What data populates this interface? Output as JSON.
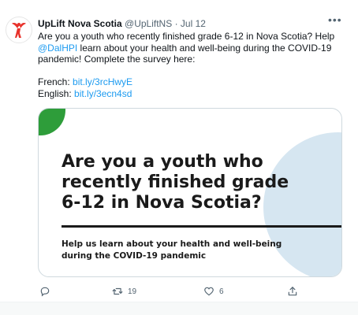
{
  "tweet": {
    "display_name": "UpLift Nova Scotia",
    "handle": "@UpLiftNS",
    "separator": "·",
    "date": "Jul 12",
    "more_icon": "more-horizontal-icon",
    "text_line1": "Are you a youth who recently finished grade 6-12 in Nova Scotia? Help",
    "mention": "@DalHPI",
    "text_line2_rest": " learn about your health and well-being during the COVID-19",
    "text_line3": "pandemic! Complete the survey here:",
    "french_label": "French: ",
    "french_link": "bit.ly/3rcHwyE",
    "english_label": "English: ",
    "english_link": "bit.ly/3ecn4sd"
  },
  "card": {
    "headline_lines": [
      "Are you a youth who",
      "recently finished grade",
      "6-12 in Nova Scotia?"
    ],
    "sub_lines": [
      "Help us learn about your health and well-being",
      "during the COVID-19 pandemic"
    ]
  },
  "actions": {
    "reply_icon": "reply-icon",
    "retweet_icon": "retweet-icon",
    "retweet_count": "19",
    "like_icon": "heart-icon",
    "like_count": "6",
    "share_icon": "share-icon"
  },
  "colors": {
    "link": "#1d9bf0",
    "secondary_text": "#536471",
    "card_green": "#2e9d3a",
    "card_blue": "#d6e6f1",
    "logo_red": "#e8322b"
  }
}
